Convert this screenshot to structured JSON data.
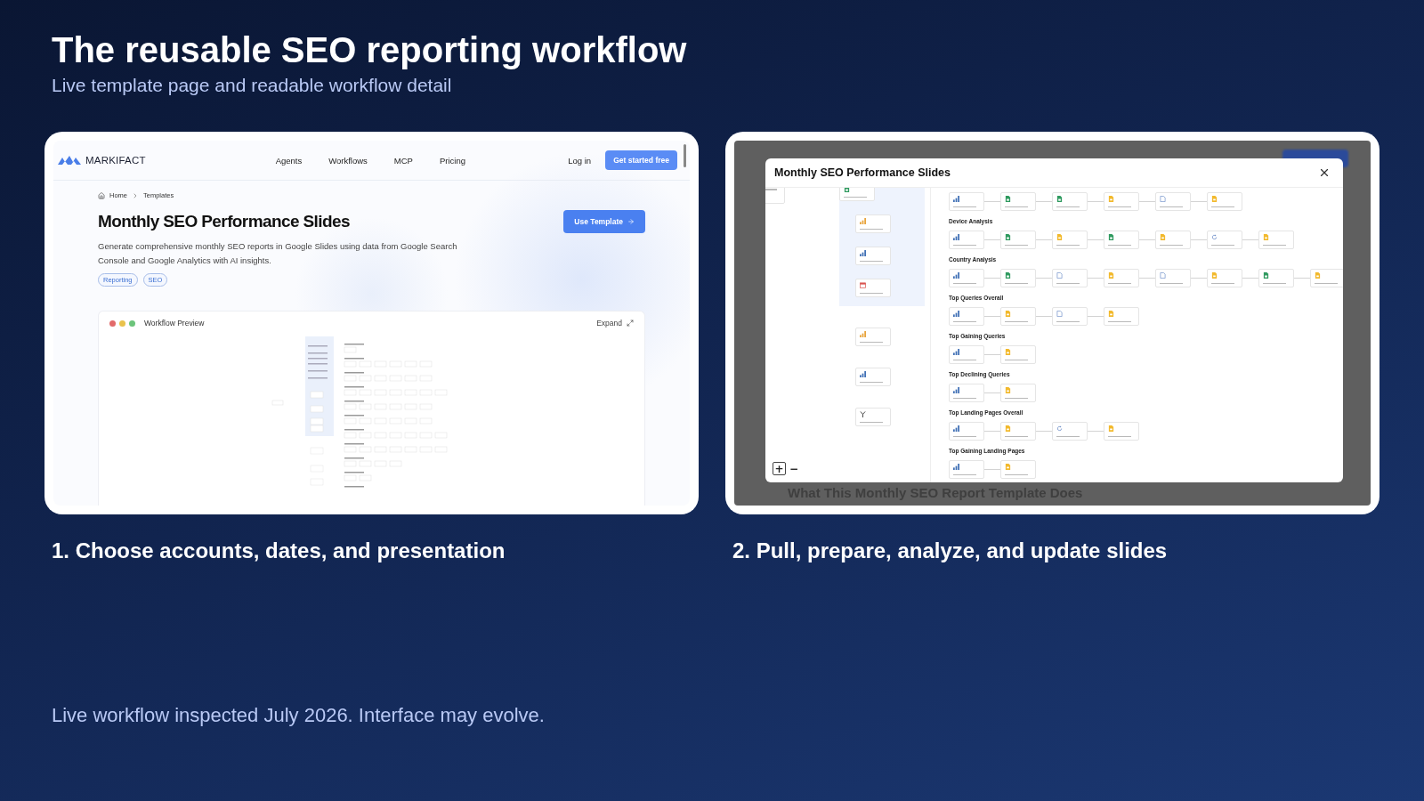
{
  "slide": {
    "title": "The reusable SEO reporting workflow",
    "subtitle": "Live template page and readable workflow detail"
  },
  "template_page": {
    "logo": "MARKIFACT",
    "nav_links": [
      "Agents",
      "Workflows",
      "MCP",
      "Pricing"
    ],
    "login": "Log in",
    "cta": "Get started free",
    "breadcrumb": [
      "Home",
      "Templates"
    ],
    "title": "Monthly SEO Performance Slides",
    "description": "Generate comprehensive monthly SEO reports in Google Slides using data from Google Search Console and Google Analytics with AI insights.",
    "tags": [
      "Reporting",
      "SEO"
    ],
    "use_template": "Use Template",
    "preview": {
      "title": "Workflow Preview",
      "expand": "Expand"
    },
    "caption": "1. Choose accounts, dates, and presentation"
  },
  "workflow_modal": {
    "background_heading": "What This Monthly SEO Report Template Does",
    "title": "Monthly SEO Performance Slides",
    "setup_group": [
      {
        "kind": "sheet"
      },
      {
        "kind": "ga"
      },
      {
        "kind": "gsc"
      },
      {
        "kind": "calendar"
      }
    ],
    "checks": [
      {
        "kind": "ga"
      },
      {
        "kind": "gsc"
      },
      {
        "kind": "split"
      }
    ],
    "sections": [
      {
        "nodes": [
          {
            "kind": "gsc"
          },
          {
            "kind": "sheet"
          },
          {
            "kind": "sheet"
          },
          {
            "kind": "slide"
          },
          {
            "kind": "doc"
          },
          {
            "kind": "slide"
          }
        ]
      },
      {
        "title": "Device Analysis",
        "nodes": [
          {
            "kind": "gsc"
          },
          {
            "kind": "sheet"
          },
          {
            "kind": "slide"
          },
          {
            "kind": "sheet"
          },
          {
            "kind": "slide"
          },
          {
            "kind": "ai"
          },
          {
            "kind": "slide"
          }
        ]
      },
      {
        "title": "Country Analysis",
        "nodes": [
          {
            "kind": "gsc"
          },
          {
            "kind": "sheet"
          },
          {
            "kind": "doc"
          },
          {
            "kind": "slide"
          },
          {
            "kind": "doc"
          },
          {
            "kind": "slide"
          },
          {
            "kind": "sheet"
          },
          {
            "kind": "slide"
          }
        ]
      },
      {
        "title": "Top Queries Overall",
        "nodes": [
          {
            "kind": "gsc"
          },
          {
            "kind": "slide"
          },
          {
            "kind": "doc"
          },
          {
            "kind": "slide"
          }
        ]
      },
      {
        "title": "Top Gaining Queries",
        "nodes": [
          {
            "kind": "gsc"
          },
          {
            "kind": "slide"
          }
        ]
      },
      {
        "title": "Top Declining Queries",
        "nodes": [
          {
            "kind": "gsc"
          },
          {
            "kind": "slide"
          }
        ]
      },
      {
        "title": "Top Landing Pages Overall",
        "nodes": [
          {
            "kind": "gsc"
          },
          {
            "kind": "slide"
          },
          {
            "kind": "ai"
          },
          {
            "kind": "slide"
          }
        ]
      },
      {
        "title": "Top Gaining Landing Pages",
        "nodes": [
          {
            "kind": "gsc"
          },
          {
            "kind": "slide"
          }
        ]
      }
    ],
    "zoom_in": "+",
    "zoom_out": "−",
    "caption": "2. Pull, prepare, analyze, and update slides"
  },
  "footer": "Live workflow inspected July 2026. Interface may evolve."
}
